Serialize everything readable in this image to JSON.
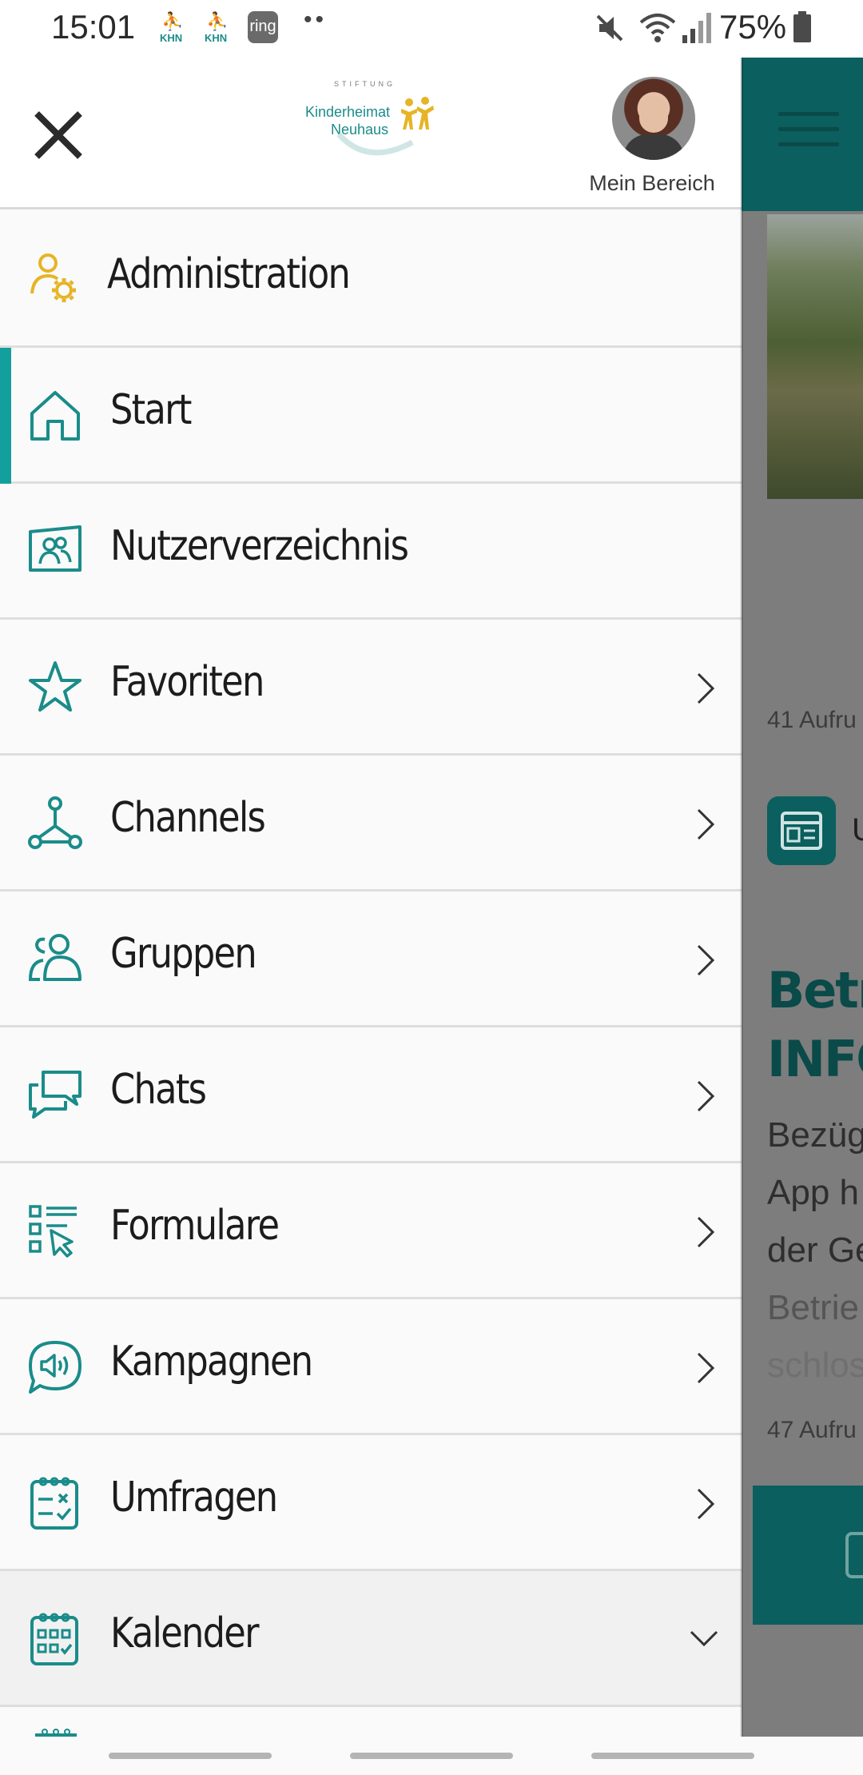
{
  "status_bar": {
    "time": "15:01",
    "notif_khn_label": "KHN",
    "notif_ring": "ring",
    "more_dots": "••",
    "battery_pct": "75%"
  },
  "drawer": {
    "close_icon": "close-icon",
    "logo": {
      "small": "STIFTUNG",
      "line1": "Kinderheimat",
      "line2": "Neuhaus"
    },
    "profile_label": "Mein Bereich",
    "items": [
      {
        "label": "Administration",
        "icon": "admin-user-gear-icon",
        "chevron": "none"
      },
      {
        "label": "Start",
        "icon": "home-icon",
        "chevron": "none",
        "active": true
      },
      {
        "label": "Nutzerverzeichnis",
        "icon": "user-directory-icon",
        "chevron": "none"
      },
      {
        "label": "Favoriten",
        "icon": "star-icon",
        "chevron": "right"
      },
      {
        "label": "Channels",
        "icon": "channels-network-icon",
        "chevron": "right"
      },
      {
        "label": "Gruppen",
        "icon": "group-icon",
        "chevron": "right"
      },
      {
        "label": "Chats",
        "icon": "chat-bubbles-icon",
        "chevron": "right"
      },
      {
        "label": "Formulare",
        "icon": "form-checklist-icon",
        "chevron": "right"
      },
      {
        "label": "Kampagnen",
        "icon": "megaphone-bubble-icon",
        "chevron": "right"
      },
      {
        "label": "Umfragen",
        "icon": "survey-clipboard-icon",
        "chevron": "right"
      },
      {
        "label": "Kalender",
        "icon": "calendar-icon",
        "chevron": "down"
      }
    ]
  },
  "background": {
    "views_1": "41 Aufru",
    "section_initial": "U",
    "title_line1": "Betrie",
    "title_line2": "INFO-A",
    "body_line1": "Bezüg",
    "body_line2": "App h",
    "body_line3": "der Ge",
    "body_line4": "Betrie",
    "body_line5": "schlos",
    "views_2": "47 Aufru"
  },
  "colors": {
    "accent": "#13a09d",
    "icon_teal": "#1a8c8a",
    "admin_yellow": "#e6b426",
    "header_dark_teal": "#0b5f5e"
  }
}
